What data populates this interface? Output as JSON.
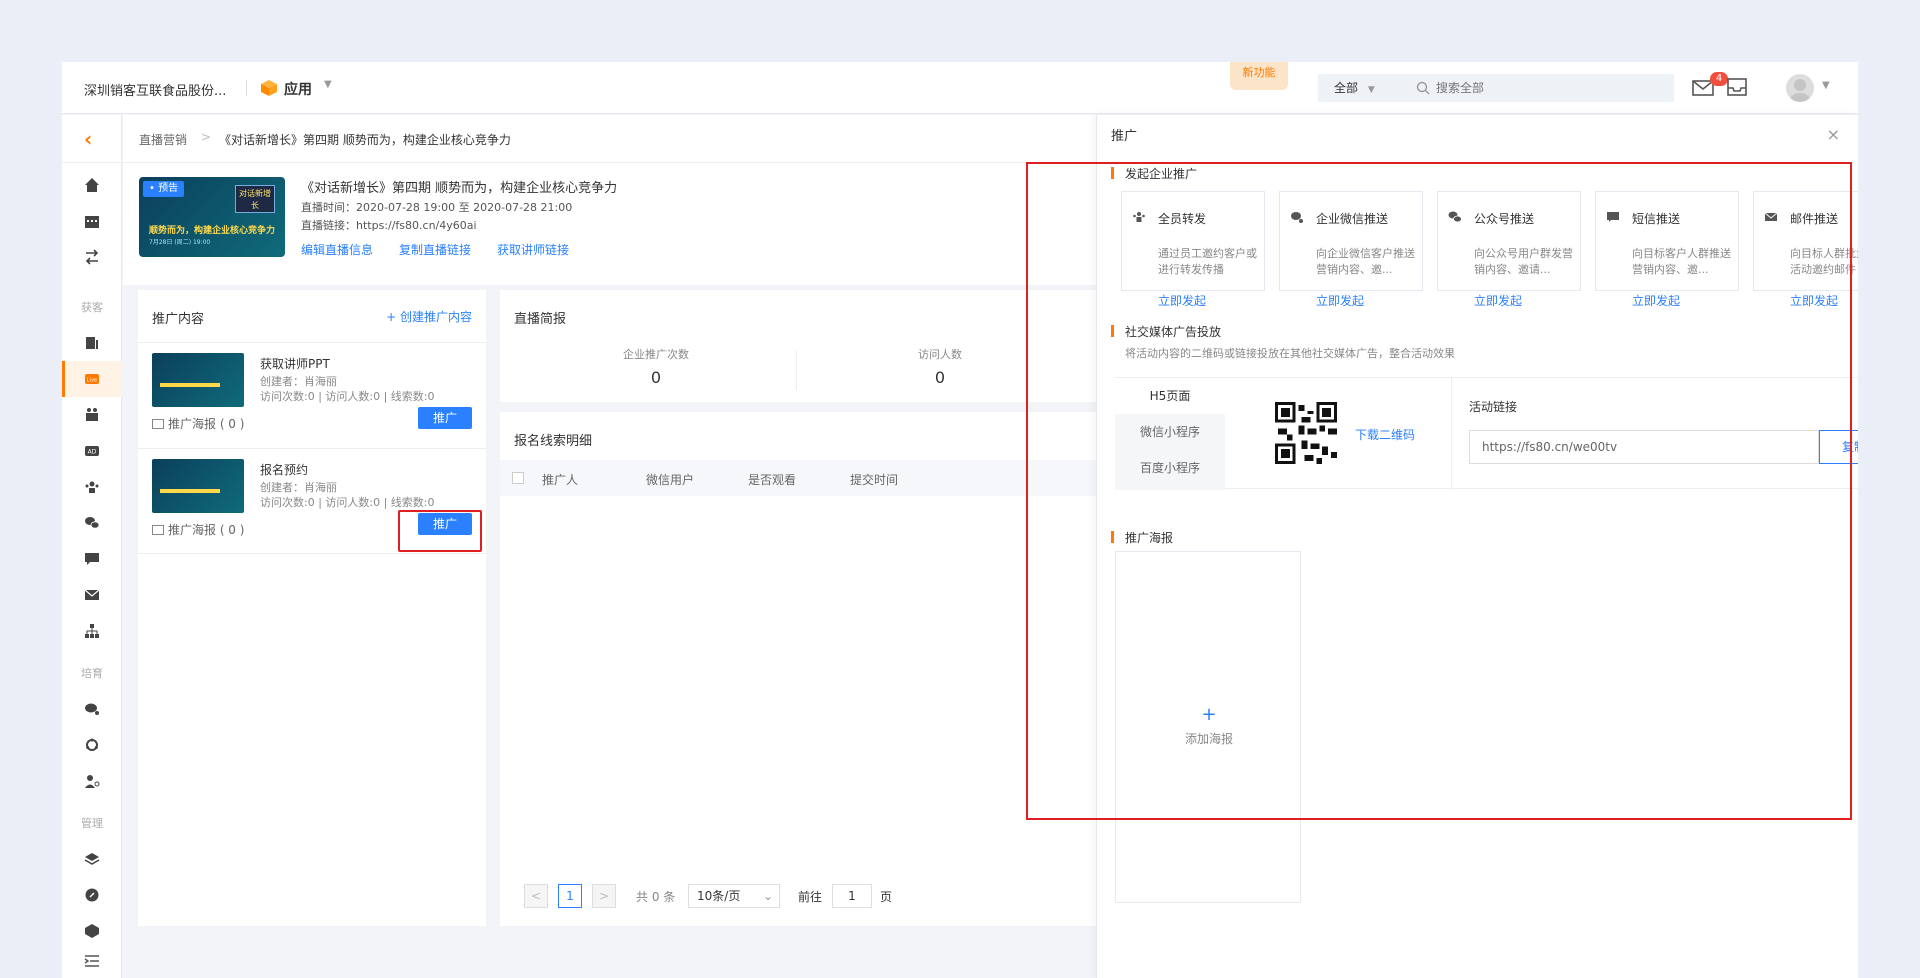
{
  "topbar": {
    "company": "深圳销客互联食品股份...",
    "app_label": "应用",
    "new_feature": "新功能",
    "search_scope": "全部",
    "search_placeholder": "搜索全部",
    "message_count": "4"
  },
  "nav": {
    "groups": [
      "获客",
      "培育",
      "管理"
    ]
  },
  "breadcrumb": {
    "parent": "直播营销",
    "separator": ">",
    "current": "《对话新增长》第四期 顺势而为，构建企业核心竞争力"
  },
  "live": {
    "cover_tag": "• 预告",
    "cover_badge": "对话新增长",
    "cover_headline": "顺势而为，构建企业核心竞争力",
    "cover_sub": "7月28日 (周二) 19:00",
    "title": "《对话新增长》第四期 顺势而为，构建企业核心竞争力",
    "time": "直播时间：2020-07-28 19:00 至 2020-07-28 21:00",
    "link": "直播链接：https://fs80.cn/4y60ai",
    "actions": [
      "编辑直播信息",
      "复制直播链接",
      "获取讲师链接"
    ]
  },
  "promo": {
    "title": "推广内容",
    "create": "+ 创建推广内容",
    "items": [
      {
        "name": "获取讲师PPT",
        "creator": "创建者：肖海丽",
        "stats": "访问次数:0 | 访问人数:0 | 线索数:0",
        "poster": "推广海报 ( 0 )",
        "button": "推广"
      },
      {
        "name": "报名预约",
        "creator": "创建者：肖海丽",
        "stats": "访问次数:0 | 访问人数:0 | 线索数:0",
        "poster": "推广海报 ( 0 )",
        "button": "推广"
      }
    ]
  },
  "report": {
    "title": "直播简报",
    "metrics": [
      {
        "label": "企业推广次数",
        "value": "0"
      },
      {
        "label": "访问人数",
        "value": "0"
      }
    ]
  },
  "leads": {
    "title": "报名线索明细",
    "columns": [
      "推广人",
      "微信用户",
      "是否观看",
      "提交时间"
    ],
    "pager": {
      "prev": "<",
      "current": "1",
      "next": ">",
      "total": "共 0 条",
      "page_size": "10条/页",
      "goto_label": "前往",
      "goto_value": "1",
      "page_suffix": "页"
    }
  },
  "drawer": {
    "title": "推广",
    "close": "×",
    "section1": "发起企业推广",
    "cards": [
      {
        "title": "全员转发",
        "desc": "通过员工邀约客户或进行转发传播",
        "link": "立即发起"
      },
      {
        "title": "企业微信推送",
        "desc": "向企业微信客户推送营销内容、邀...",
        "link": "立即发起"
      },
      {
        "title": "公众号推送",
        "desc": "向公众号用户群发营销内容、邀请...",
        "link": "立即发起"
      },
      {
        "title": "短信推送",
        "desc": "向目标客户人群推送营销内容、邀...",
        "link": "立即发起"
      },
      {
        "title": "邮件推送",
        "desc": "向目标人群批量群发活动邀约邮件",
        "link": "立即发起"
      }
    ],
    "section2": "社交媒体广告投放",
    "section2_desc": "将活动内容的二维码或链接投放在其他社交媒体广告，整合活动效果",
    "qr_tabs": [
      "H5页面",
      "微信小程序",
      "百度小程序"
    ],
    "download_qr": "下载二维码",
    "link_label": "活动链接",
    "link_value": "https://fs80.cn/we00tv",
    "copy": "复制",
    "section3": "推广海报",
    "add_poster_plus": "+",
    "add_poster": "添加海报"
  }
}
